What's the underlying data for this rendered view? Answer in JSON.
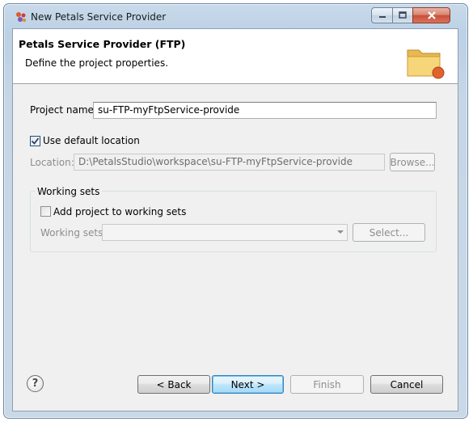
{
  "window": {
    "title": "New Petals Service Provider",
    "controls": {
      "minimize": "minimize",
      "maximize": "maximize",
      "close": "close"
    }
  },
  "banner": {
    "title": "Petals Service Provider (FTP)",
    "description": "Define the project properties."
  },
  "form": {
    "project_name_label": "Project name:",
    "project_name_value": "su-FTP-myFtpService-provide",
    "use_default_location_label": "Use default location",
    "use_default_location_checked": true,
    "location_label": "Location:",
    "location_value": "D:\\PetalsStudio\\workspace\\su-FTP-myFtpService-provide",
    "browse_label": "Browse..."
  },
  "working_sets": {
    "group_title": "Working sets",
    "add_label": "Add project to working sets",
    "add_checked": false,
    "field_label": "Working sets:",
    "field_value": "",
    "select_label": "Select..."
  },
  "footer": {
    "help_symbol": "?",
    "back_label": "< Back",
    "next_label": "Next >",
    "finish_label": "Finish",
    "cancel_label": "Cancel"
  },
  "icons": {
    "app": "petals-app-icon",
    "banner": "folder-icon",
    "help": "help-icon"
  },
  "colors": {
    "accent": "#3c7fb1",
    "disabled_text": "#8d8d8d"
  }
}
